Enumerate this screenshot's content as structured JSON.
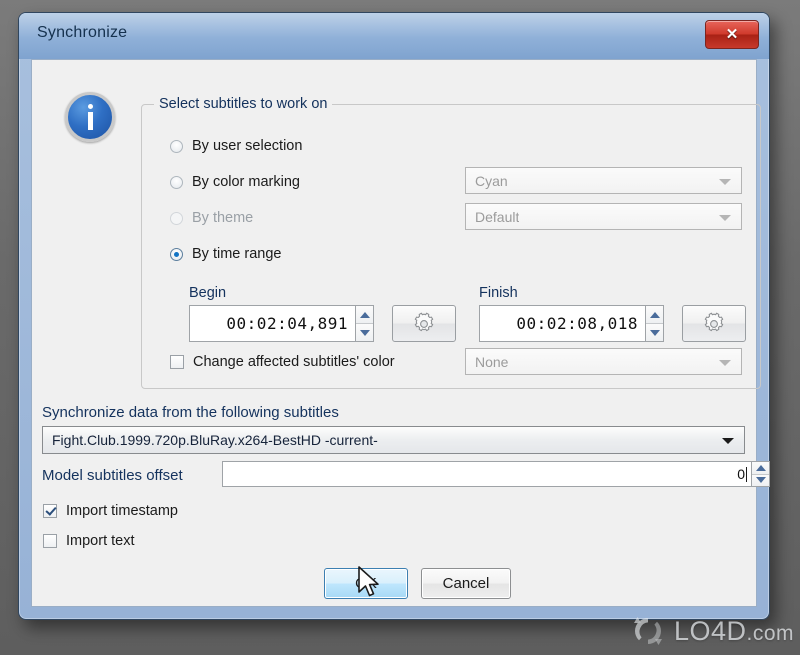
{
  "window": {
    "title": "Synchronize",
    "close_label": "✕"
  },
  "icons": {
    "info": "info-icon",
    "gear": "gear-icon",
    "close": "close-icon",
    "chevron_down": "chevron-down-icon",
    "cursor": "mouse-cursor"
  },
  "groupbox": {
    "legend": "Select subtitles to work on",
    "options": [
      {
        "label": "By user selection",
        "selected": false,
        "disabled": false
      },
      {
        "label": "By color marking",
        "selected": false,
        "disabled": false
      },
      {
        "label": "By theme",
        "selected": false,
        "disabled": true
      },
      {
        "label": "By time range",
        "selected": true,
        "disabled": false
      }
    ],
    "color_marking_value": "Cyan",
    "theme_value": "Default",
    "time_range": {
      "begin_label": "Begin",
      "begin_value": "00:02:04,891",
      "finish_label": "Finish",
      "finish_value": "00:02:08,018"
    },
    "change_color": {
      "label": "Change affected subtitles' color",
      "checked": false,
      "value": "None"
    }
  },
  "source": {
    "label": "Synchronize data from the following subtitles",
    "value": "Fight.Club.1999.720p.BluRay.x264-BestHD  -current-"
  },
  "offset": {
    "label": "Model subtitles offset",
    "value": "0"
  },
  "import_options": [
    {
      "label": "Import timestamp",
      "checked": true
    },
    {
      "label": "Import text",
      "checked": false
    }
  ],
  "buttons": {
    "ok": "OK",
    "cancel": "Cancel"
  },
  "watermark": {
    "name": "LO4D",
    "domain": ".com"
  },
  "colors": {
    "accent": "#1273c4",
    "title_bar": "#8fb0d8",
    "close_red": "#c7392b",
    "default_button": "#bee6fd"
  }
}
